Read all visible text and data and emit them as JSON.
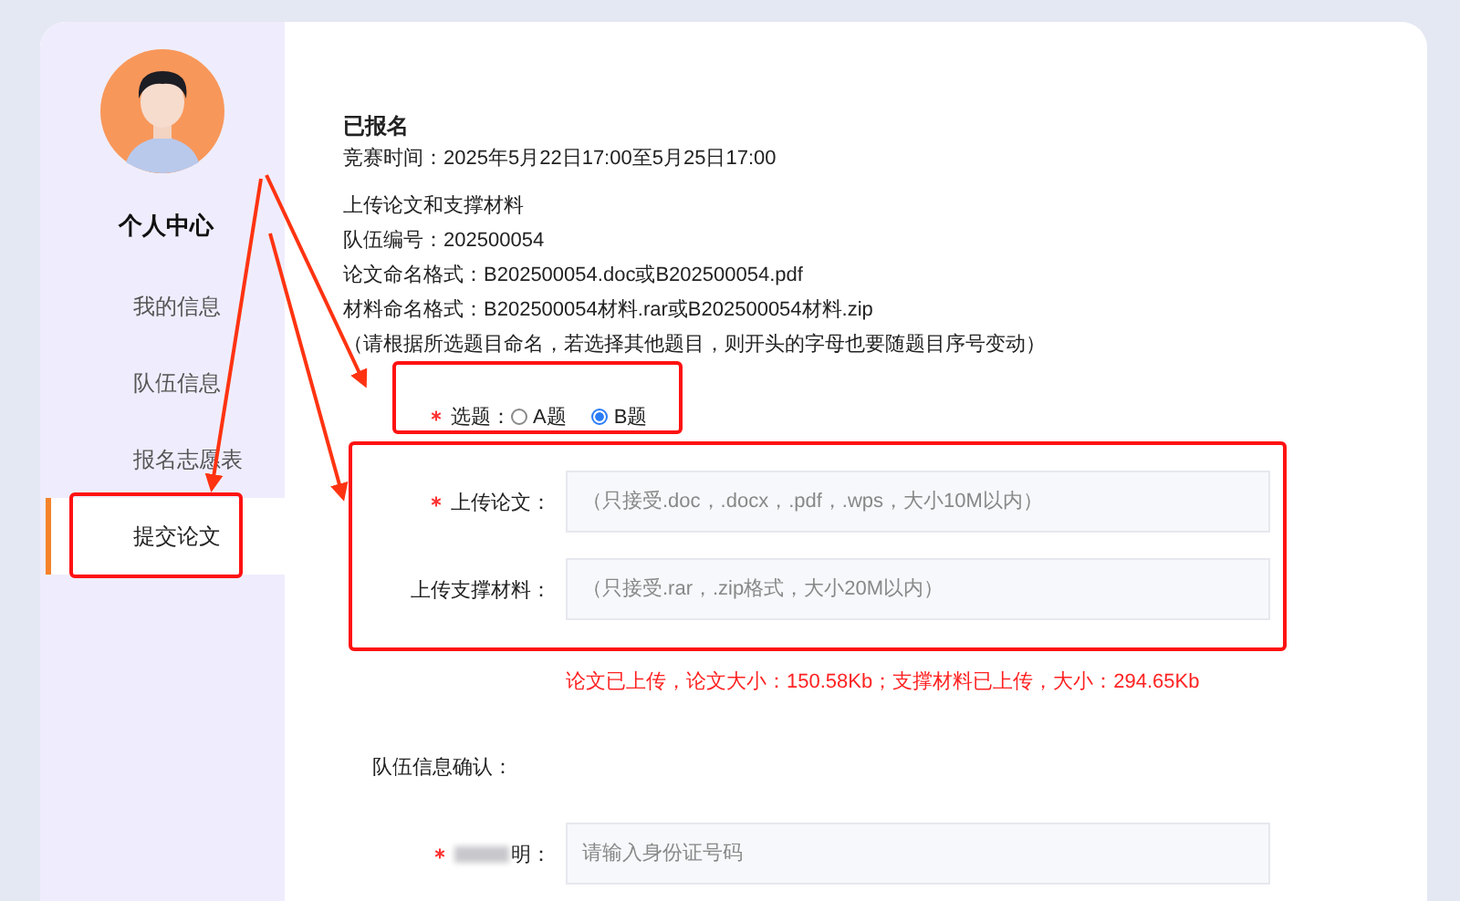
{
  "sidebar": {
    "title": "个人中心",
    "items": [
      {
        "label": "我的信息",
        "selected": false
      },
      {
        "label": "队伍信息",
        "selected": false
      },
      {
        "label": "报名志愿表",
        "selected": false
      },
      {
        "label": "提交论文",
        "selected": true
      }
    ]
  },
  "main": {
    "heading": "已报名",
    "time": "竞赛时间：2025年5月22日17:00至5月25日17:00",
    "notes": [
      "上传论文和支撑材料",
      "队伍编号：202500054",
      "论文命名格式：B202500054.doc或B202500054.pdf",
      "材料命名格式：B202500054材料.rar或B202500054材料.zip",
      "（请根据所选题目命名，若选择其他题目，则开头的字母也要随题目序号变动）"
    ],
    "topic": {
      "label": "选题：",
      "required": true,
      "options": [
        {
          "label": "A题",
          "selected": false
        },
        {
          "label": "B题",
          "selected": true
        }
      ]
    },
    "uploads": [
      {
        "label": "上传论文：",
        "required": true,
        "placeholder": "（只接受.doc，.docx，.pdf，.wps，大小10M以内）"
      },
      {
        "label": "上传支撑材料：",
        "required": false,
        "placeholder": "（只接受.rar，.zip格式，大小20M以内）"
      }
    ],
    "status": "论文已上传，论文大小：150.58Kb；支撑材料已上传，大小：294.65Kb",
    "team_confirm": "队伍信息确认：",
    "id_field": {
      "label": "明：",
      "required": true,
      "placeholder": "请输入身份证号码"
    }
  }
}
